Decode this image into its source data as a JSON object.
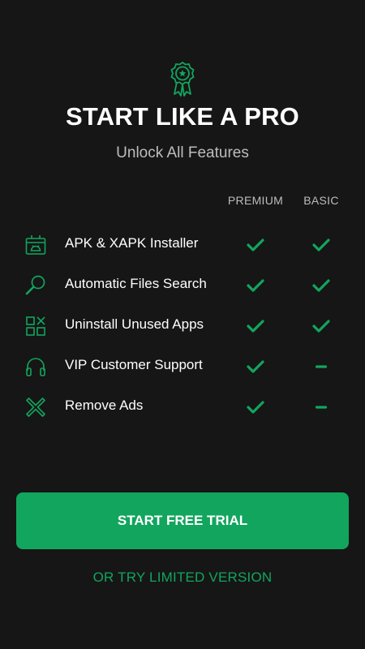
{
  "header": {
    "badge_icon": "award-ribbon-icon",
    "title": "START LIKE A PRO",
    "subtitle": "Unlock All Features"
  },
  "columns": {
    "premium": "PREMIUM",
    "basic": "BASIC"
  },
  "features": [
    {
      "icon": "android-package-icon",
      "label": "APK & XAPK Installer",
      "premium": "check",
      "basic": "check"
    },
    {
      "icon": "search-icon",
      "label": "Automatic Files Search",
      "premium": "check",
      "basic": "check"
    },
    {
      "icon": "apps-grid-remove-icon",
      "label": "Uninstall Unused Apps",
      "premium": "check",
      "basic": "check"
    },
    {
      "icon": "headphones-icon",
      "label": "VIP Customer Support",
      "premium": "check",
      "basic": "dash"
    },
    {
      "icon": "remove-ads-icon",
      "label": "Remove Ads",
      "premium": "check",
      "basic": "dash"
    }
  ],
  "actions": {
    "primary_label": "START FREE TRIAL",
    "secondary_label": "OR TRY LIMITED VERSION"
  },
  "colors": {
    "accent": "#12a55e",
    "background": "#161616",
    "muted_text": "#bdbdbd"
  }
}
